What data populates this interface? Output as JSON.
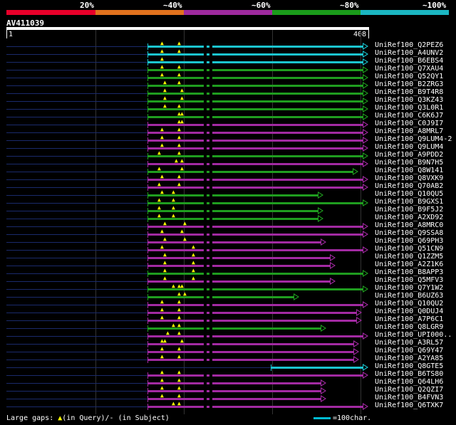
{
  "legend": {
    "ticks": [
      "20%",
      "~40%",
      "~60%",
      "~80%",
      "~100%"
    ],
    "colors": [
      "#ff0000",
      "#ff6600",
      "#cc00cc",
      "#00cc00",
      "#00cccc"
    ]
  },
  "query": {
    "id": "AV411039",
    "start": "1",
    "end": "408"
  },
  "hits": [
    {
      "label": "UniRef100_Q2PEZ6",
      "color": "cyan"
    },
    {
      "label": "UniRef100_A4UNV2",
      "color": "cyan"
    },
    {
      "label": "UniRef100_B6EBS4",
      "color": "cyan"
    },
    {
      "label": "UniRef100_Q7XAU4",
      "color": "green"
    },
    {
      "label": "UniRef100_Q52QY1",
      "color": "green"
    },
    {
      "label": "UniRef100_B2ZRG3",
      "color": "green"
    },
    {
      "label": "UniRef100_B9T4R8",
      "color": "green"
    },
    {
      "label": "UniRef100_Q3KZ43",
      "color": "green"
    },
    {
      "label": "UniRef100_Q3L0R1",
      "color": "green"
    },
    {
      "label": "UniRef100_C6K6J7",
      "color": "green"
    },
    {
      "label": "UniRef100_C0J9I7",
      "color": "magenta"
    },
    {
      "label": "UniRef100_A8MRL7",
      "color": "magenta"
    },
    {
      "label": "UniRef100_Q9LUM4-2",
      "color": "magenta"
    },
    {
      "label": "UniRef100_Q9LUM4",
      "color": "magenta"
    },
    {
      "label": "UniRef100_A9PDD2",
      "color": "green"
    },
    {
      "label": "UniRef100_B9N7H5",
      "color": "magenta"
    },
    {
      "label": "UniRef100_Q8W141",
      "color": "green"
    },
    {
      "label": "UniRef100_Q8VXK9",
      "color": "magenta"
    },
    {
      "label": "UniRef100_Q70AB2",
      "color": "magenta"
    },
    {
      "label": "UniRef100_Q10QU5",
      "color": "green"
    },
    {
      "label": "UniRef100_B9GXS1",
      "color": "green"
    },
    {
      "label": "UniRef100_B9F5J2",
      "color": "green"
    },
    {
      "label": "UniRef100_A2XD92",
      "color": "green"
    },
    {
      "label": "UniRef100_A8MRC0",
      "color": "magenta"
    },
    {
      "label": "UniRef100_Q9SSA8",
      "color": "magenta"
    },
    {
      "label": "UniRef100_Q69PH3",
      "color": "magenta"
    },
    {
      "label": "UniRef100_Q51CN9",
      "color": "magenta"
    },
    {
      "label": "UniRef100_Q1ZZM5",
      "color": "magenta"
    },
    {
      "label": "UniRef100_A2Z1K6",
      "color": "magenta"
    },
    {
      "label": "UniRef100_B8APP3",
      "color": "green"
    },
    {
      "label": "UniRef100_Q5MFV3",
      "color": "magenta"
    },
    {
      "label": "UniRef100_Q7Y1W2",
      "color": "green"
    },
    {
      "label": "UniRef100_B6UZ63",
      "color": "green"
    },
    {
      "label": "UniRef100_Q10QU2",
      "color": "magenta"
    },
    {
      "label": "UniRef100_Q0DUJ4",
      "color": "magenta"
    },
    {
      "label": "UniRef100_A7P6C1",
      "color": "magenta"
    },
    {
      "label": "UniRef100_Q8LGR9",
      "color": "green"
    },
    {
      "label": "UniRef100_UPI000..",
      "color": "magenta"
    },
    {
      "label": "UniRef100_A3RL57",
      "color": "magenta"
    },
    {
      "label": "UniRef100_Q69Y47",
      "color": "magenta"
    },
    {
      "label": "UniRef100_A2YA85",
      "color": "magenta"
    },
    {
      "label": "UniRef100_Q8GTE5",
      "color": "cyan"
    },
    {
      "label": "UniRef100_B6TS80",
      "color": "magenta"
    },
    {
      "label": "UniRef100_Q64LH6",
      "color": "magenta"
    },
    {
      "label": "UniRef100_Q2QZI7",
      "color": "magenta"
    },
    {
      "label": "UniRef100_B4FVN3",
      "color": "magenta"
    },
    {
      "label": "UniRef100_Q6TXK7",
      "color": "magenta"
    }
  ],
  "footer": {
    "prefix": "Large gaps: ",
    "query_gap": "(in Query)/",
    "dash": "-",
    "subject_gap": " (in Subject)",
    "scale_text": "=100char."
  }
}
